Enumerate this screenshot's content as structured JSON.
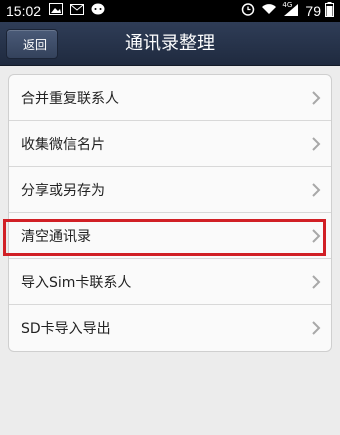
{
  "status_bar": {
    "time": "15:02",
    "network": "4G",
    "battery": "79",
    "icons": [
      "gallery-icon",
      "mail-icon",
      "chat-icon",
      "alarm-icon",
      "wifi-icon",
      "signal-icon",
      "battery-icon"
    ]
  },
  "header": {
    "back_label": "返回",
    "title": "通讯录整理"
  },
  "menu": {
    "items": [
      {
        "label": "合并重复联系人"
      },
      {
        "label": "收集微信名片"
      },
      {
        "label": "分享或另存为"
      },
      {
        "label": "清空通讯录"
      },
      {
        "label": "导入Sim卡联系人"
      },
      {
        "label": "SD卡导入导出"
      }
    ]
  },
  "highlight": {
    "color": "#d11f25",
    "item_index": 3
  }
}
